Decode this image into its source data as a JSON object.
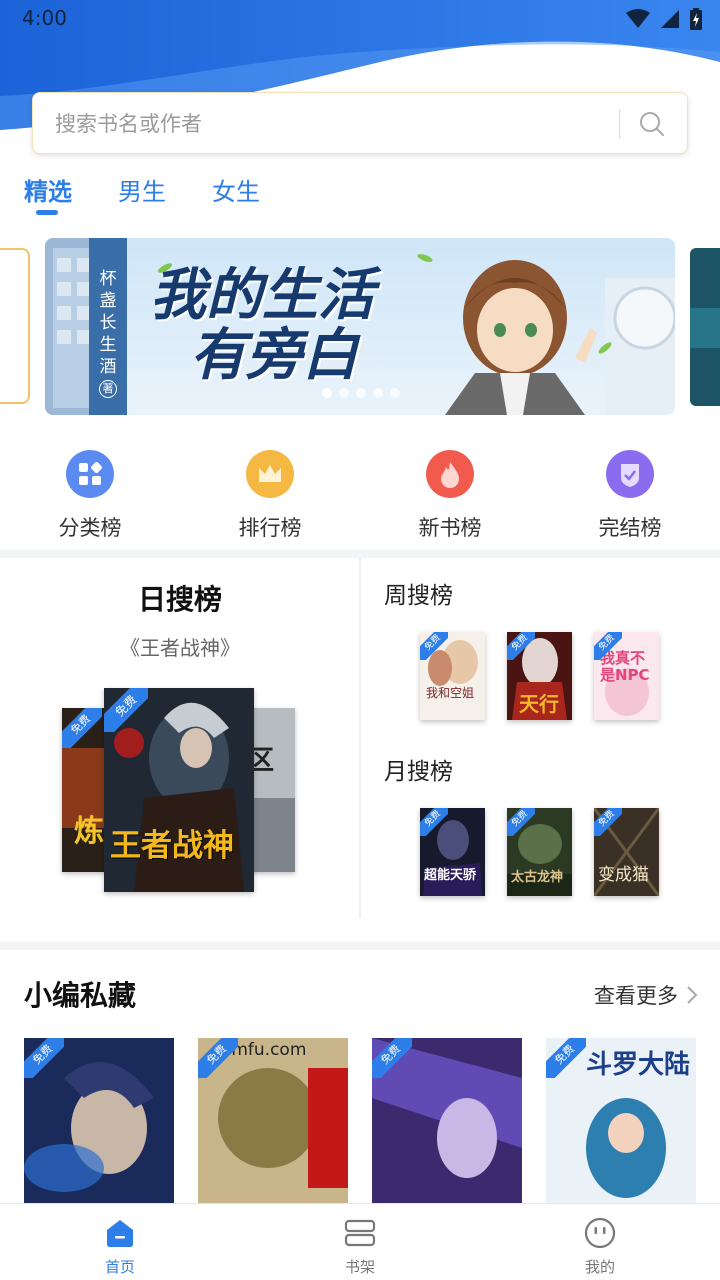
{
  "status_bar": {
    "time": "4:00"
  },
  "search": {
    "placeholder": "搜索书名或作者"
  },
  "tabs": [
    {
      "label": "精选",
      "active": true
    },
    {
      "label": "男生",
      "active": false
    },
    {
      "label": "女生",
      "active": false
    }
  ],
  "banner": {
    "author": "杯盏长生酒",
    "author_suffix": "著",
    "title_line1": "我的生活",
    "title_line2": "有旁白",
    "page_count": 5,
    "active_index": 0
  },
  "quick_entries": [
    {
      "label": "分类榜",
      "icon": "grid-icon",
      "color": "#5b8af0"
    },
    {
      "label": "排行榜",
      "icon": "crown-icon",
      "color": "#f5a623"
    },
    {
      "label": "新书榜",
      "icon": "flame-icon",
      "color": "#f15b4e"
    },
    {
      "label": "完结榜",
      "icon": "shield-check-icon",
      "color": "#8b6cf0"
    }
  ],
  "daily_rank": {
    "title": "日搜榜",
    "book_name": "《王者战神》",
    "covers": [
      {
        "title": "炼",
        "badge": "免费"
      },
      {
        "title": "王者战神",
        "badge": "免费"
      },
      {
        "title": "禁区",
        "badge": "免费"
      }
    ]
  },
  "weekly_rank": {
    "title": "周搜榜",
    "covers": [
      {
        "title": "我和空姐",
        "badge": "免费"
      },
      {
        "title": "天行",
        "badge": "免费"
      },
      {
        "title": "我真不是NPC",
        "badge": "免费"
      }
    ]
  },
  "monthly_rank": {
    "title": "月搜榜",
    "covers": [
      {
        "title": "超能天骄",
        "badge": "免费"
      },
      {
        "title": "太古龙神",
        "badge": "免费"
      },
      {
        "title": "变成猫",
        "badge": "免费"
      }
    ]
  },
  "editor_picks": {
    "title": "小编私藏",
    "see_more": "查看更多",
    "covers": [
      {
        "badge": "免费",
        "title": ""
      },
      {
        "badge": "免费",
        "title": "cmfu.com"
      },
      {
        "badge": "免费",
        "title": ""
      },
      {
        "badge": "免费",
        "title": "斗罗大陆"
      }
    ]
  },
  "bottom_nav": [
    {
      "label": "首页",
      "icon": "home-icon",
      "active": true
    },
    {
      "label": "书架",
      "icon": "bookshelf-icon",
      "active": false
    },
    {
      "label": "我的",
      "icon": "profile-icon",
      "active": false
    }
  ],
  "colors": {
    "accent": "#2d7ee8",
    "header": "#1e6be0"
  }
}
